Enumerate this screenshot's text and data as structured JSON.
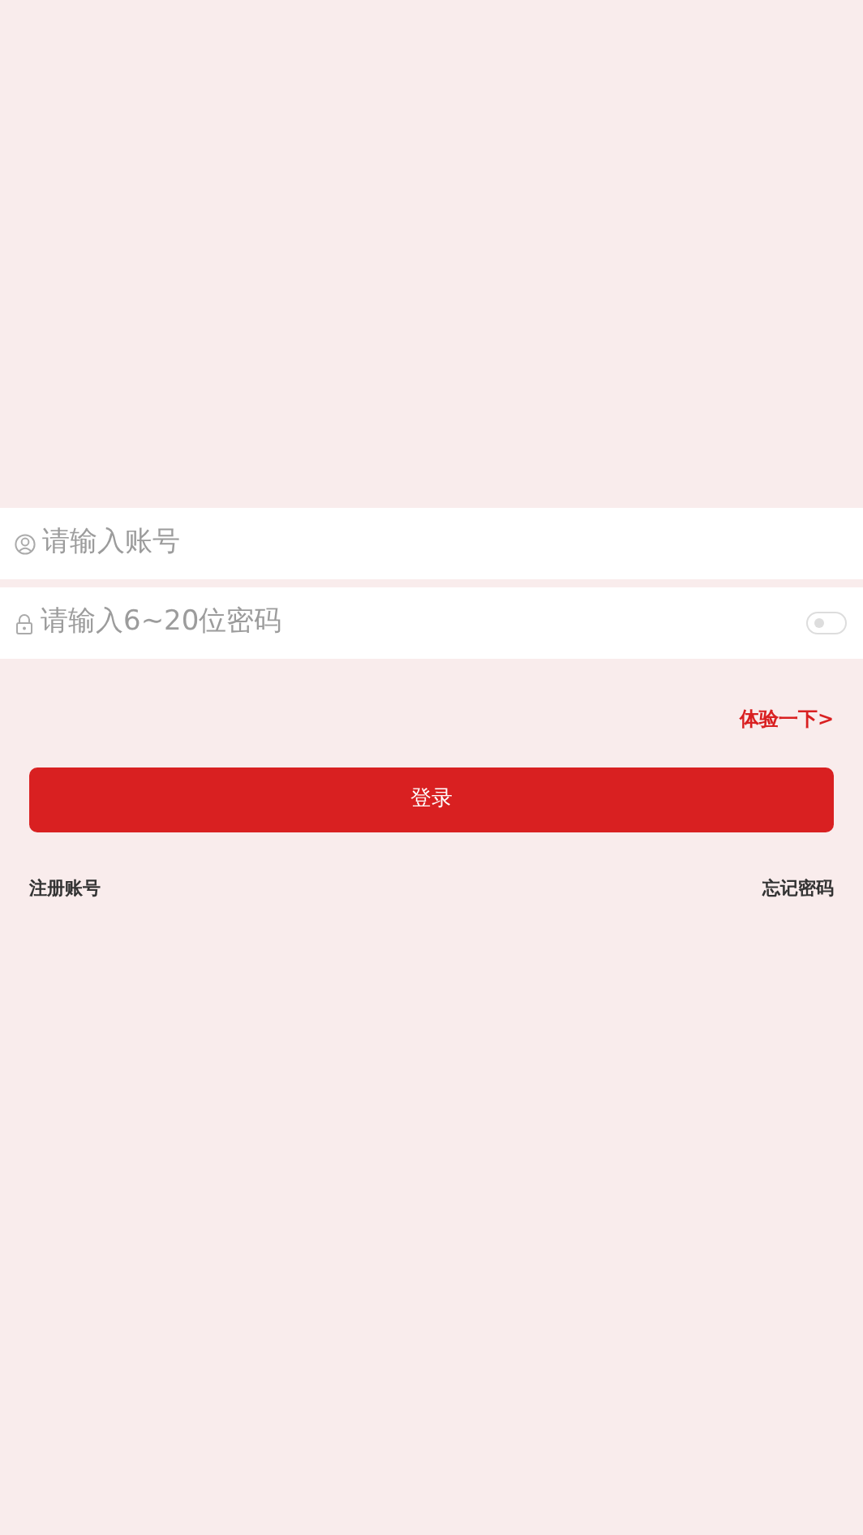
{
  "account_field": {
    "placeholder": "请输入账号"
  },
  "password_field": {
    "placeholder": "请输入6~20位密码",
    "show_password": false
  },
  "trial_link": "体验一下>",
  "login_button": "登录",
  "links": [
    {
      "kind": "register",
      "label": "注册账号"
    },
    {
      "kind": "forgot",
      "label": "忘记密码"
    }
  ]
}
